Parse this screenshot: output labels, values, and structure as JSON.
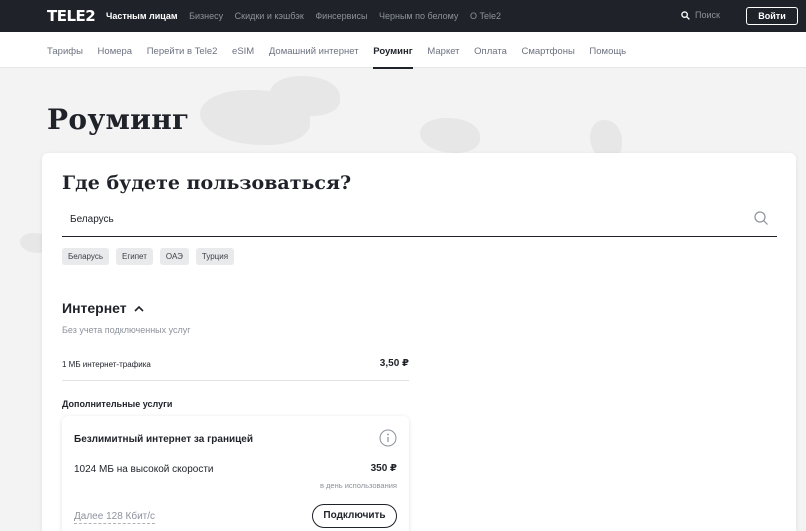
{
  "header": {
    "logo": "TELE2",
    "nav": [
      "Частным лицам",
      "Бизнесу",
      "Скидки и кэшбэк",
      "Финсервисы",
      "Черным по белому",
      "О Tele2"
    ],
    "active_nav_index": 0,
    "search_label": "Поиск",
    "login_label": "Войти"
  },
  "subnav": {
    "items": [
      "Тарифы",
      "Номера",
      "Перейти в Tele2",
      "eSIM",
      "Домашний интернет",
      "Роуминг",
      "Маркет",
      "Оплата",
      "Смартфоны",
      "Помощь"
    ],
    "active_index": 5
  },
  "page": {
    "title": "Роуминг"
  },
  "card": {
    "title": "Где будете пользоваться?",
    "country_value": "Беларусь",
    "chips": [
      "Беларусь",
      "Египет",
      "ОАЭ",
      "Турция"
    ],
    "internet": {
      "title": "Интернет",
      "subtitle": "Без учета подключенных услуг",
      "row_label": "1 МБ интернет-трафика",
      "row_value": "3,50 ₽"
    },
    "extra_title": "Дополнительные услуги",
    "service": {
      "name": "Безлимитный интернет за границей",
      "speed_label": "1024 МБ на высокой скорости",
      "price": "350 ₽",
      "per": "в день использования",
      "after": "Далее 128 Кбит/с",
      "button": "Подключить"
    }
  },
  "colors": {
    "dark": "#1f2229",
    "muted": "#8d929b",
    "background": "#f3f3f3"
  },
  "icons": {
    "search": "search-icon",
    "chevron": "chevron-up-icon",
    "info": "info-icon"
  }
}
